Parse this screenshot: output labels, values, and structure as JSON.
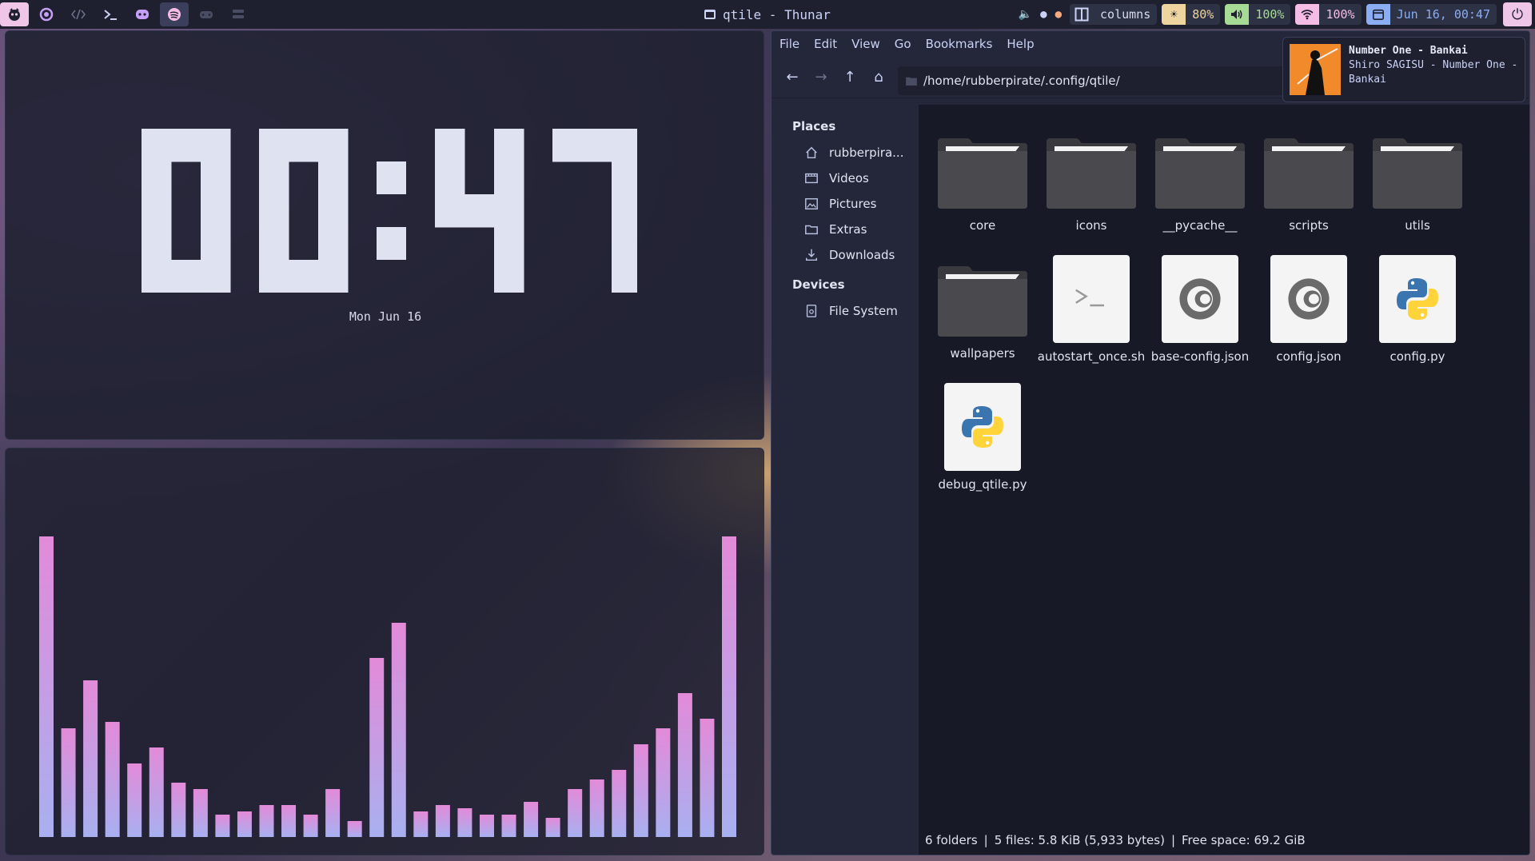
{
  "topbar": {
    "window_title": "qtile - Thunar",
    "layout_name": "columns",
    "brightness": "80%",
    "volume": "100%",
    "wifi": "100%",
    "datetime": "Jun 16, 00:47",
    "colors": {
      "brightness": "#eed49f",
      "volume": "#a6da95",
      "wifi": "#f5bde6",
      "date": "#8aadf4",
      "power": "#f0c6e8"
    }
  },
  "clock": {
    "time": "00:47",
    "date": "Mon Jun 16"
  },
  "visualizer": {
    "levels": [
      0.94,
      0.34,
      0.49,
      0.36,
      0.23,
      0.28,
      0.17,
      0.15,
      0.07,
      0.08,
      0.1,
      0.1,
      0.07,
      0.15,
      0.05,
      0.56,
      0.67,
      0.08,
      0.1,
      0.09,
      0.07,
      0.07,
      0.11,
      0.06,
      0.15,
      0.18,
      0.21,
      0.29,
      0.34,
      0.45,
      0.37,
      0.94
    ],
    "color_top": "#e38ad8",
    "color_bottom": "#a8b0f0"
  },
  "thunar": {
    "menu": [
      "File",
      "Edit",
      "View",
      "Go",
      "Bookmarks",
      "Help"
    ],
    "path": "/home/rubberpirate/.config/qtile/",
    "places_heading": "Places",
    "places": [
      {
        "label": "rubberpira...",
        "icon": "home-icon"
      },
      {
        "label": "Videos",
        "icon": "video-icon"
      },
      {
        "label": "Pictures",
        "icon": "image-icon"
      },
      {
        "label": "Extras",
        "icon": "folder-icon"
      },
      {
        "label": "Downloads",
        "icon": "download-icon"
      }
    ],
    "devices_heading": "Devices",
    "devices": [
      {
        "label": "File System",
        "icon": "drive-icon"
      }
    ],
    "items": [
      {
        "name": "core",
        "kind": "folder"
      },
      {
        "name": "icons",
        "kind": "folder"
      },
      {
        "name": "__pycache__",
        "kind": "folder"
      },
      {
        "name": "scripts",
        "kind": "folder"
      },
      {
        "name": "utils",
        "kind": "folder"
      },
      {
        "name": "wallpapers",
        "kind": "folder"
      },
      {
        "name": "autostart_once.sh",
        "kind": "shell"
      },
      {
        "name": "base-config.json",
        "kind": "json"
      },
      {
        "name": "config.json",
        "kind": "json"
      },
      {
        "name": "config.py",
        "kind": "python"
      },
      {
        "name": "debug_qtile.py",
        "kind": "python"
      }
    ],
    "status": {
      "folders": "6 folders",
      "files": "5 files: 5.8 KiB (5,933 bytes)",
      "free": "Free space: 69.2 GiB"
    }
  },
  "notification": {
    "title": "Number One - Bankai",
    "body": "Shiro SAGISU - Number One - Bankai"
  }
}
